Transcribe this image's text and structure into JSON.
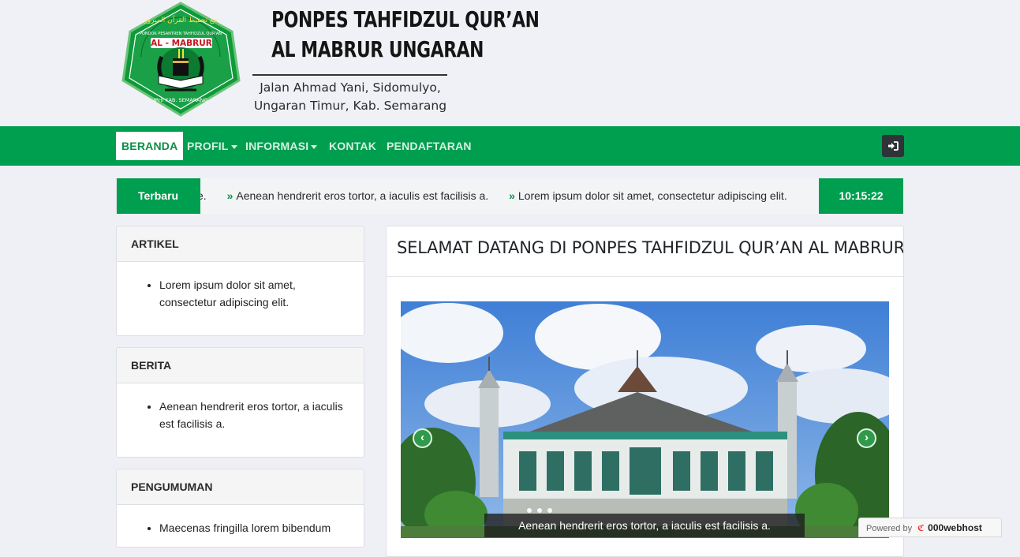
{
  "header": {
    "logo_text": {
      "arabic": "مع تحفيظ القرآن المبرور",
      "top": "PONDOK PESANTREN TAHFIDZUL QUR'AN",
      "name": "AL - MABRUR",
      "bottom": "IPHI KAB. SEMARANG"
    },
    "title_line1": "PONPES TAHFIDZUL QUR’AN",
    "title_line2": "AL MABRUR UNGARAN",
    "address_line1": "Jalan Ahmad Yani, Sidomulyo,",
    "address_line2": "Ungaran Timur, Kab. Semarang"
  },
  "nav": {
    "items": [
      {
        "label": "BERANDA"
      },
      {
        "label": "PROFIL"
      },
      {
        "label": "INFORMASI"
      },
      {
        "label": "KONTAK"
      },
      {
        "label": "PENDAFTARAN"
      }
    ],
    "login_icon": "sign-in-icon"
  },
  "ticker": {
    "label": "Terbaru",
    "lead": "e.",
    "items": [
      "Aenean hendrerit eros tortor, a iaculis est facilisis a.",
      "Lorem ipsum dolor sit amet, consectetur adipiscing elit."
    ],
    "clock": "10:15:22"
  },
  "sidebar": [
    {
      "title": "ARTIKEL",
      "items": [
        "Lorem ipsum dolor sit amet, consectetur adipiscing elit."
      ]
    },
    {
      "title": "BERITA",
      "items": [
        "Aenean hendrerit eros tortor, a iaculis est facilisis a."
      ]
    },
    {
      "title": "PENGUMUMAN",
      "items": [
        "Maecenas fringilla lorem bibendum"
      ]
    }
  ],
  "main": {
    "title": "SELAMAT DATANG DI PONPES TAHFIDZUL QUR’AN AL MABRUR",
    "carousel": {
      "caption": "Aenean hendrerit eros tortor, a iaculis est facilisis a.",
      "prev_icon": "chevron-left-icon",
      "next_icon": "chevron-right-icon"
    }
  },
  "footer_badge": {
    "powered": "Powered by",
    "brand": "000webhost"
  },
  "colors": {
    "brand_green": "#009e4f",
    "background": "#eef0f5",
    "dark_button": "#2e3338"
  }
}
